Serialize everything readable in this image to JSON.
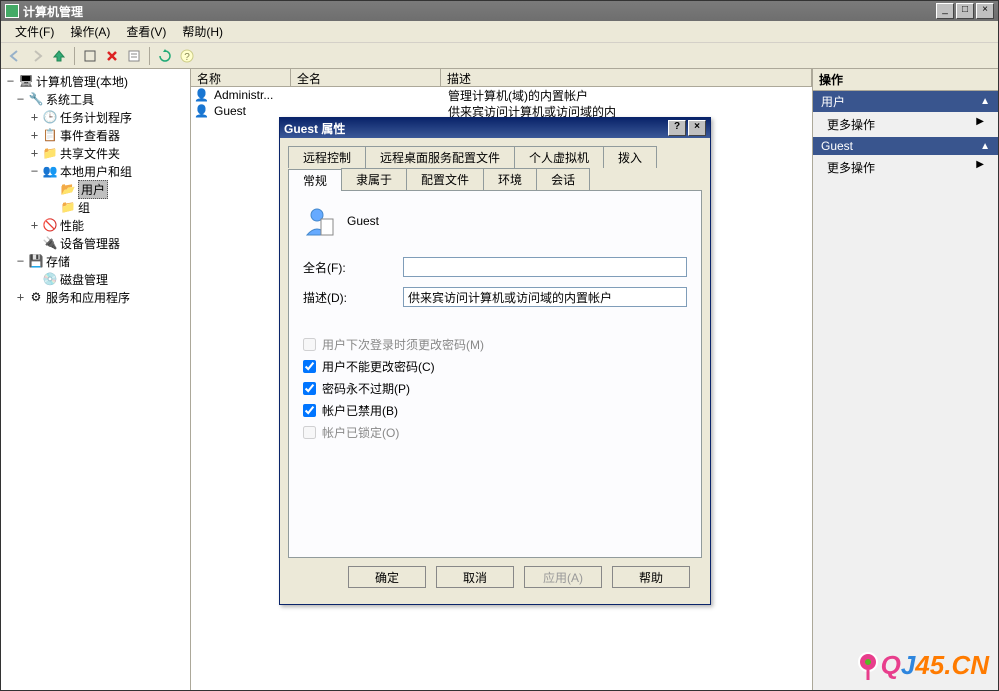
{
  "window": {
    "title": "计算机管理"
  },
  "menu": [
    "文件(F)",
    "操作(A)",
    "查看(V)",
    "帮助(H)"
  ],
  "tree": {
    "root": "计算机管理(本地)",
    "n1": "系统工具",
    "n1_1": "任务计划程序",
    "n1_2": "事件查看器",
    "n1_3": "共享文件夹",
    "n1_4": "本地用户和组",
    "n1_4_1": "用户",
    "n1_4_2": "组",
    "n1_5": "性能",
    "n1_6": "设备管理器",
    "n2": "存储",
    "n2_1": "磁盘管理",
    "n3": "服务和应用程序"
  },
  "list": {
    "cols": {
      "c1": "名称",
      "c2": "全名",
      "c3": "描述"
    },
    "rows": [
      {
        "name": "Administr...",
        "full": "",
        "desc": "管理计算机(域)的内置帐户"
      },
      {
        "name": "Guest",
        "full": "",
        "desc": "供来宾访问计算机或访问域的内"
      }
    ]
  },
  "actions": {
    "hdr": "操作",
    "s1": "用户",
    "s2": "Guest",
    "more": "更多操作"
  },
  "dialog": {
    "title": "Guest 属性",
    "tabs_row1": [
      "远程控制",
      "远程桌面服务配置文件",
      "个人虚拟机",
      "拨入"
    ],
    "tabs_row2": [
      "常规",
      "隶属于",
      "配置文件",
      "环境",
      "会话"
    ],
    "username": "Guest",
    "full_label": "全名(F):",
    "full_value": "",
    "desc_label": "描述(D):",
    "desc_value": "供来宾访问计算机或访问域的内置帐户",
    "chk1": "用户下次登录时须更改密码(M)",
    "chk2": "用户不能更改密码(C)",
    "chk3": "密码永不过期(P)",
    "chk4": "帐户已禁用(B)",
    "chk5": "帐户已锁定(O)",
    "btn_ok": "确定",
    "btn_cancel": "取消",
    "btn_apply": "应用(A)",
    "btn_help": "帮助"
  },
  "watermark": "QJ45.CN"
}
